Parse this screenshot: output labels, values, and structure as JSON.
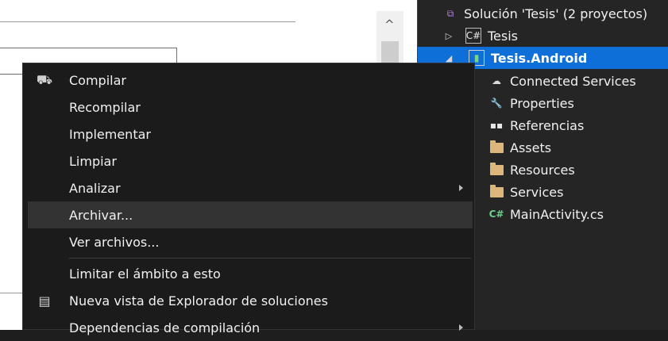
{
  "solution_explorer": {
    "items": [
      {
        "label": "Solución 'Tesis'  (2 proyectos)",
        "icon": "solution-icon"
      },
      {
        "label": "Tesis",
        "icon": "csharp-project-icon"
      },
      {
        "label": "Tesis.Android",
        "icon": "android-project-icon"
      },
      {
        "label": "Connected Services",
        "icon": "cloud-icon"
      },
      {
        "label": "Properties",
        "icon": "wrench-icon"
      },
      {
        "label": "Referencias",
        "icon": "references-icon"
      },
      {
        "label": "Assets",
        "icon": "folder-icon"
      },
      {
        "label": "Resources",
        "icon": "folder-icon"
      },
      {
        "label": "Services",
        "icon": "folder-icon"
      },
      {
        "label": "MainActivity.cs",
        "icon": "csharp-file-icon"
      }
    ],
    "selected": "Tesis.Android"
  },
  "context_menu": {
    "items": [
      {
        "label": "Compilar"
      },
      {
        "label": "Recompilar"
      },
      {
        "label": "Implementar"
      },
      {
        "label": "Limpiar"
      },
      {
        "label": "Analizar"
      },
      {
        "label": "Archivar..."
      },
      {
        "label": "Ver archivos..."
      },
      {
        "label": "Limitar el ámbito a esto"
      },
      {
        "label": "Nueva vista de Explorador de soluciones"
      },
      {
        "label": "Dependencias de compilación"
      }
    ],
    "hovered": "Archivar..."
  },
  "glyphs": {
    "scroll_up": "^",
    "expand_collapsed": "▷",
    "expand_open": "◢",
    "cs_badge": "C#",
    "android_badge": "▮",
    "cloud": "☁",
    "wrench": "🔧",
    "references": "▪▪",
    "csfile": "C#",
    "solution": "⧉",
    "build": "⛟",
    "new_view": "▤"
  },
  "colors": {
    "selection": "#0e6fd8",
    "menu_bg": "#1b1b1c",
    "menu_hover": "#333334",
    "explorer_bg": "#252526"
  }
}
